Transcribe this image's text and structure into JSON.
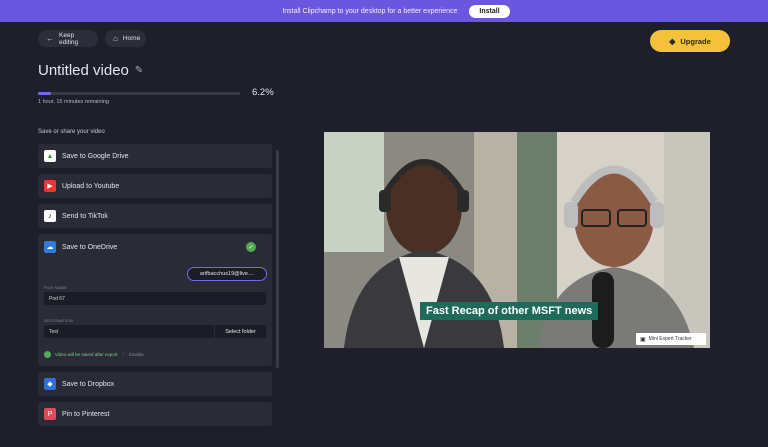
{
  "banner": {
    "text": "Install Clipchamp to your desktop for a better experience",
    "button": "Install"
  },
  "nav": {
    "keep_editing": "Keep editing",
    "home": "Home",
    "upgrade": "Upgrade"
  },
  "video": {
    "title": "Untitled video",
    "progress_percent_label": "6.2%",
    "progress_fraction": 0.062,
    "remaining": "1 hour, 15 minutes remaining"
  },
  "export": {
    "section_label": "Save or share your video",
    "options": [
      {
        "label": "Save to Google Drive",
        "icon": "google-drive-icon",
        "color": "#ffffff"
      },
      {
        "label": "Upload to Youtube",
        "icon": "youtube-icon",
        "color": "#e53935"
      },
      {
        "label": "Send to TikTok",
        "icon": "tiktok-icon",
        "color": "#ffffff"
      },
      {
        "label": "Save to OneDrive",
        "icon": "onedrive-icon",
        "color": "#2f7bd8"
      },
      {
        "label": "Save to Dropbox",
        "icon": "dropbox-icon",
        "color": "#2f6fd8"
      },
      {
        "label": "Pin to Pinterest",
        "icon": "pinterest-icon",
        "color": "#e04a5a"
      }
    ],
    "onedrive": {
      "account": "arifbacchus19@live....",
      "filename_label": "FILE NAME",
      "filename_value": "Pod 67",
      "destination_label": "DESTINATION",
      "destination_value": "Test",
      "select_folder": "Select folder",
      "saved_note": "Video will be saved after export",
      "disable": "Disable"
    }
  },
  "preview": {
    "caption": "Fast Recap of other MSFT news",
    "tracker": "Mini Expert Tracker"
  },
  "colors": {
    "banner": "#6b56e0",
    "accent": "#6f6cf0",
    "upgrade": "#f5c13a",
    "caption_bg": "#1e6b5c"
  }
}
